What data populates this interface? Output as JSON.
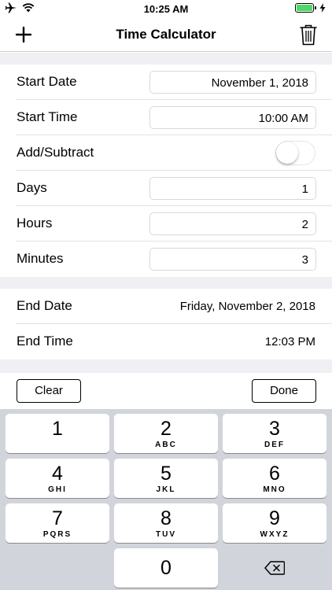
{
  "status_bar": {
    "time": "10:25 AM",
    "icons": [
      "airplane-icon",
      "wifi-icon",
      "battery-icon",
      "charging-icon"
    ],
    "battery_color": "#4cd964"
  },
  "nav": {
    "title": "Time Calculator",
    "left_icon": "plus-icon",
    "right_icon": "trash-icon"
  },
  "inputs": {
    "start_date": {
      "label": "Start Date",
      "value": "November 1, 2018"
    },
    "start_time": {
      "label": "Start Time",
      "value": "10:00 AM"
    },
    "add_subtract": {
      "label": "Add/Subtract",
      "on": false
    },
    "days": {
      "label": "Days",
      "value": "1"
    },
    "hours": {
      "label": "Hours",
      "value": "2"
    },
    "minutes": {
      "label": "Minutes",
      "value": "3"
    }
  },
  "results": {
    "end_date": {
      "label": "End Date",
      "value": "Friday, November 2, 2018"
    },
    "end_time": {
      "label": "End Time",
      "value": "12:03 PM"
    }
  },
  "accessory": {
    "clear_label": "Clear",
    "done_label": "Done"
  },
  "keyboard": {
    "keys": [
      {
        "digit": "1",
        "letters": ""
      },
      {
        "digit": "2",
        "letters": "ABC"
      },
      {
        "digit": "3",
        "letters": "DEF"
      },
      {
        "digit": "4",
        "letters": "GHI"
      },
      {
        "digit": "5",
        "letters": "JKL"
      },
      {
        "digit": "6",
        "letters": "MNO"
      },
      {
        "digit": "7",
        "letters": "PQRS"
      },
      {
        "digit": "8",
        "letters": "TUV"
      },
      {
        "digit": "9",
        "letters": "WXYZ"
      },
      {
        "digit": "0",
        "letters": ""
      }
    ],
    "delete_icon": "backspace-icon"
  }
}
